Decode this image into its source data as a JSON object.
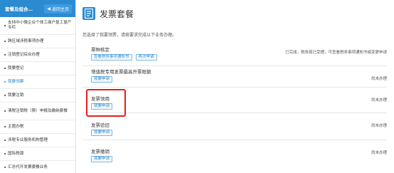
{
  "sidebar": {
    "title": "套餐及组合…",
    "back_label": "返回主页",
    "items": [
      {
        "label": "支持中小微企业个体工商户复工复产专栏"
      },
      {
        "label": "跨区域涉税事项办理"
      },
      {
        "label": "注销登记综合办理"
      },
      {
        "label": "我要登记"
      },
      {
        "label": "我要领票"
      },
      {
        "label": "我要注销"
      },
      {
        "label": "清税注销税（费）申报及缴纳套餐"
      },
      {
        "label": "主题办税"
      },
      {
        "label": "涉税专业服务机构管理"
      },
      {
        "label": "国际税源"
      },
      {
        "label": "汇总代开发票套餐业务"
      }
    ]
  },
  "main": {
    "title": "发票套餐",
    "notice": "您选择了我要领票，请按要求完成以下业务办理。",
    "tasks": [
      {
        "name": "票种核定",
        "buttons": [
          "查看税务事项通知书",
          "再次申请"
        ],
        "status": "已完成，税务局已受理，可查看税务事项通知书或变更申请"
      },
      {
        "name": "增值税专用发票最高开票限额",
        "buttons": [
          "我要申请"
        ],
        "status": "尚未办理"
      },
      {
        "name": "发票领用",
        "buttons": [
          "我要申请"
        ],
        "status": "尚未办理"
      },
      {
        "name": "发票验旧",
        "buttons": [
          "我要申请"
        ],
        "status": "尚未办理"
      },
      {
        "name": "发票缴销",
        "buttons": [
          "我要申请"
        ],
        "status": "尚未办理"
      }
    ]
  },
  "colors": {
    "accent": "#2a8bd0",
    "highlight": "#e02020"
  },
  "icons": {
    "back": "arrow-left-icon",
    "page": "document-icon"
  }
}
